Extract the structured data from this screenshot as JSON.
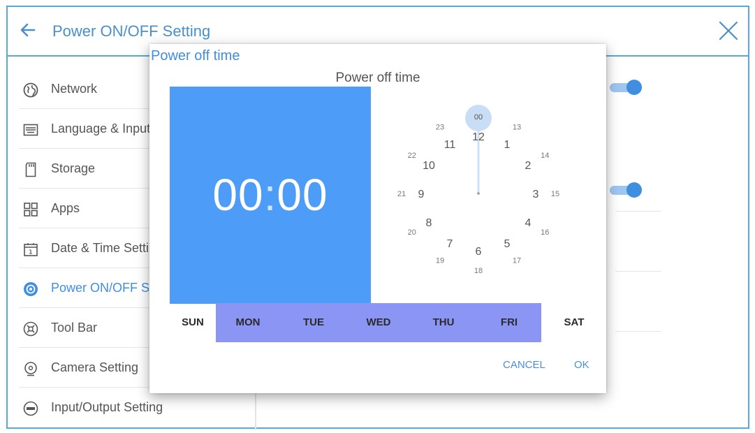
{
  "header": {
    "title": "Power ON/OFF Setting"
  },
  "sidebar": {
    "items": [
      {
        "label": "Network",
        "icon": "globe-icon"
      },
      {
        "label": "Language & Input",
        "icon": "keyboard-icon"
      },
      {
        "label": "Storage",
        "icon": "sd-card-icon"
      },
      {
        "label": "Apps",
        "icon": "apps-grid-icon"
      },
      {
        "label": "Date & Time Setting",
        "icon": "calendar-icon"
      },
      {
        "label": "Power ON/OFF Setting",
        "icon": "power-icon",
        "active": true
      },
      {
        "label": "Tool Bar",
        "icon": "toolbar-icon"
      },
      {
        "label": "Camera Setting",
        "icon": "camera-icon"
      },
      {
        "label": "Input/Output Setting",
        "icon": "input-output-icon"
      }
    ]
  },
  "dialog": {
    "title": "Power off time",
    "picker_heading": "Power off time",
    "time": {
      "hours": "00",
      "separator": ":",
      "minutes": "00"
    },
    "clock": {
      "selected": "00",
      "outer_hours": [
        "12",
        "1",
        "2",
        "3",
        "4",
        "5",
        "6",
        "7",
        "8",
        "9",
        "10",
        "11"
      ],
      "inner_hours": [
        "00",
        "13",
        "14",
        "15",
        "16",
        "17",
        "18",
        "19",
        "20",
        "21",
        "22",
        "23"
      ]
    },
    "days": [
      {
        "label": "SUN",
        "selected": false
      },
      {
        "label": "MON",
        "selected": true
      },
      {
        "label": "TUE",
        "selected": true
      },
      {
        "label": "WED",
        "selected": true
      },
      {
        "label": "THU",
        "selected": true
      },
      {
        "label": "FRI",
        "selected": true
      },
      {
        "label": "SAT",
        "selected": false
      }
    ],
    "cancel_label": "CANCEL",
    "ok_label": "OK"
  },
  "colors": {
    "accent": "#3f8ee0",
    "time_panel": "#4d9cf7",
    "day_selection": "#8b96f4",
    "frame": "#59a9d6"
  }
}
